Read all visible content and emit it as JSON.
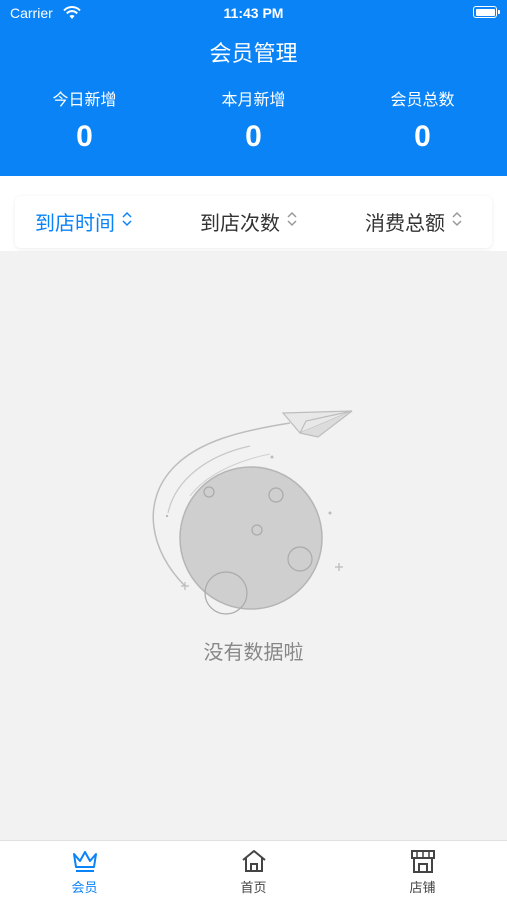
{
  "status_bar": {
    "carrier": "Carrier",
    "time": "11:43 PM"
  },
  "header": {
    "title": "会员管理",
    "stats": [
      {
        "label": "今日新增",
        "value": "0"
      },
      {
        "label": "本月新增",
        "value": "0"
      },
      {
        "label": "会员总数",
        "value": "0"
      }
    ]
  },
  "filters": [
    {
      "label": "到店时间",
      "active": true
    },
    {
      "label": "到店次数",
      "active": false
    },
    {
      "label": "消费总额",
      "active": false
    }
  ],
  "empty_state": {
    "text": "没有数据啦"
  },
  "tabbar": [
    {
      "label": "会员",
      "icon": "crown-icon",
      "active": true
    },
    {
      "label": "首页",
      "icon": "home-icon",
      "active": false
    },
    {
      "label": "店铺",
      "icon": "store-icon",
      "active": false
    }
  ],
  "colors": {
    "primary": "#0a83f7",
    "background": "#f2f2f2"
  }
}
